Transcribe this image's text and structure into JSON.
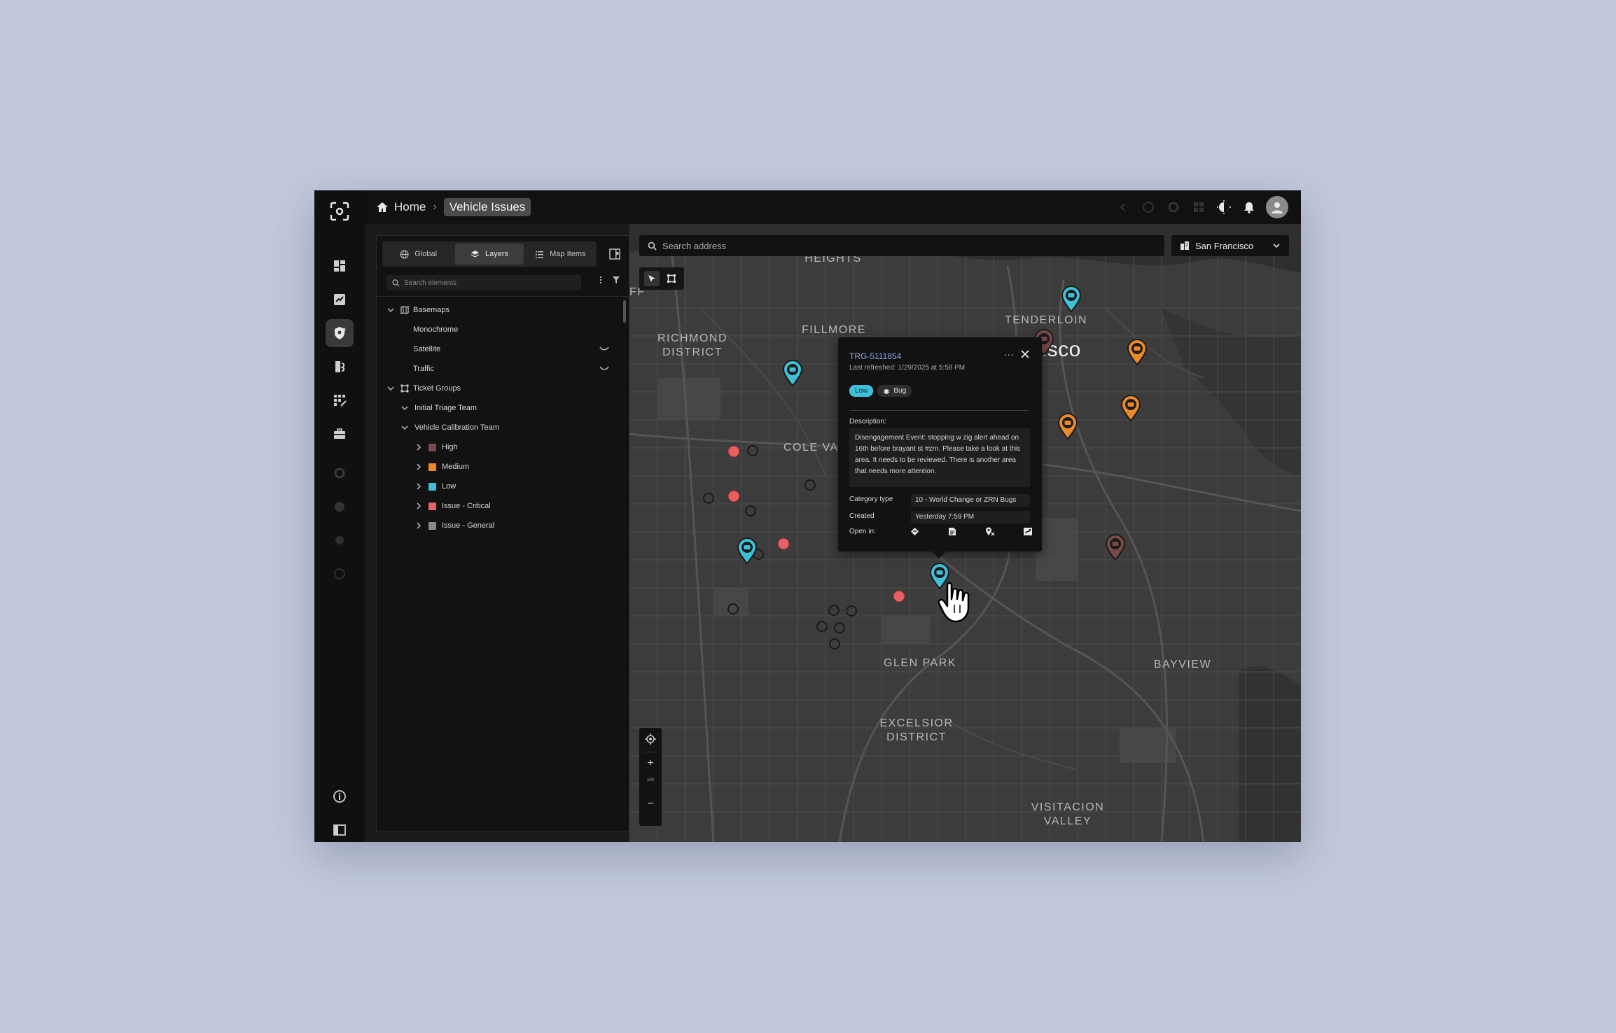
{
  "app": {
    "breadcrumb": {
      "home": "Home",
      "current": "Vehicle Issues"
    }
  },
  "rail": {
    "items": [
      "dashboard-icon",
      "analytics-icon",
      "map-shield-icon",
      "route-icon",
      "grid-icon",
      "briefcase-icon",
      "settings-icon",
      "pie-icon",
      "gear-icon",
      "help-icon"
    ],
    "active": "map-shield-icon",
    "bottom": [
      "info-icon",
      "sidebar-toggle-icon"
    ]
  },
  "panel": {
    "tabs": [
      {
        "label": "Global",
        "icon": "globe-icon"
      },
      {
        "label": "Layers",
        "icon": "layers-icon",
        "active": true
      },
      {
        "label": "Map Items",
        "icon": "list-icon"
      }
    ],
    "search_placeholder": "Search elements",
    "tree": {
      "basemaps": {
        "label": "Basemaps",
        "items": [
          "Monochrome",
          "Satellite",
          "Traffic"
        ]
      },
      "ticket_groups": {
        "label": "Ticket Groups",
        "initial": "Initial Triage Team",
        "calibration": "Vehicle Calibration Team",
        "priorities": [
          {
            "label": "High",
            "color": "#7a4a48"
          },
          {
            "label": "Medium",
            "color": "#e8892b"
          },
          {
            "label": "Low",
            "color": "#3fc0d8"
          },
          {
            "label": "Issue - Critical",
            "color": "#ea5f5f"
          },
          {
            "label": "Issue - General",
            "color": "#8a8a8a"
          }
        ]
      }
    }
  },
  "map": {
    "search_placeholder": "Search address",
    "city": "San Francisco",
    "zoom_level": "100",
    "labels": {
      "pacific": "PACIFIC\nHEIGHTS",
      "tenderloin": "TENDERLOIN",
      "fillmore": "FILLMORE",
      "richmond": "RICHMOND\nDISTRICT",
      "sf": "cisco",
      "colev": "COLE VA",
      "glen": "GLEN PARK",
      "bayview": "BAYVIEW",
      "excelsior": "EXCELSIOR\nDISTRICT",
      "visitacion": "VISITACION\nVALLEY",
      "edge": "FF"
    }
  },
  "popup": {
    "id": "TRG-5111854",
    "refreshed": "Last refreshed: 1/29/2025 at 5:58 PM",
    "priority": "Low",
    "type": "Bug",
    "description_label": "Description:",
    "description": "Disengagement Event: stopping w zig alert ahead on 16th before brayant st #zrn. Please take a look at this area. It needs to be reviewed. There is another area that needs more attention.",
    "category_label": "Category type",
    "category_value": "10 - World Change or ZRN Bugs",
    "created_label": "Created",
    "created_value": "Yesterday 7:59 PM",
    "open_label": "Open in:",
    "open_icons": [
      "diamond-icon",
      "document-icon",
      "map-pin-icon",
      "route-icon"
    ]
  }
}
